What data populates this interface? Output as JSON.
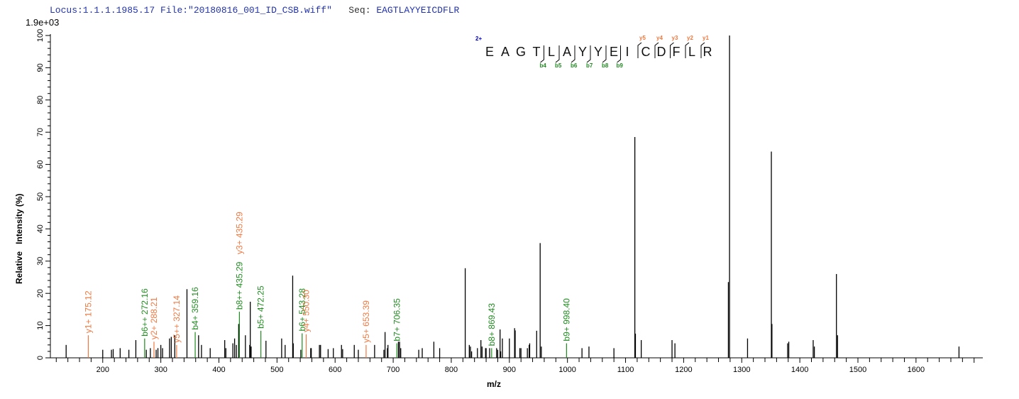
{
  "header": {
    "locus": "Locus:1.1.1.1985.17",
    "file": "File:\"20180816_001_ID_CSB.wiff\"",
    "seq_label": "Seq:",
    "seq": "EAGTLAYYEICDFLR"
  },
  "colors": {
    "b_ion": "#1e8c1e",
    "y_ion": "#f07840",
    "peak": "#000000",
    "header": "#2233aa",
    "charge": "#0000cc"
  },
  "chart_data": {
    "type": "bar",
    "title": "",
    "scale_label": "1.9e+03",
    "xlabel": "m/z",
    "ylabel": "Relative   Intensity (%)",
    "xlim": [
      105,
      1715
    ],
    "ylim": [
      0,
      100
    ],
    "x_ticks": [
      200,
      300,
      400,
      500,
      600,
      700,
      800,
      900,
      1000,
      1100,
      1200,
      1300,
      1400,
      1500,
      1600
    ],
    "y_ticks": [
      0,
      10,
      20,
      30,
      40,
      50,
      60,
      70,
      80,
      90,
      100
    ],
    "grid": false,
    "sequence_annotation": {
      "charge": "2+",
      "residues": [
        "E",
        "A",
        "G",
        "T",
        "L",
        "A",
        "Y",
        "Y",
        "E",
        "I",
        "C",
        "D",
        "F",
        "L",
        "R"
      ],
      "b_ions": [
        {
          "after": 4,
          "label": "b4"
        },
        {
          "after": 5,
          "label": "b5"
        },
        {
          "after": 6,
          "label": "b6"
        },
        {
          "after": 7,
          "label": "b7"
        },
        {
          "after": 8,
          "label": "b8"
        },
        {
          "after": 9,
          "label": "b9"
        }
      ],
      "y_ions": [
        {
          "before": 11,
          "label": "y5"
        },
        {
          "before": 12,
          "label": "y4"
        },
        {
          "before": 13,
          "label": "y3"
        },
        {
          "before": 14,
          "label": "y2"
        },
        {
          "before": 15,
          "label": "y1"
        }
      ]
    },
    "peaks": [
      {
        "mz": 137,
        "i": 4
      },
      {
        "mz": 175.12,
        "i": 7,
        "label": "y1+ 175.12",
        "ion": "y"
      },
      {
        "mz": 200,
        "i": 2.5
      },
      {
        "mz": 215,
        "i": 2.5
      },
      {
        "mz": 218,
        "i": 2.7
      },
      {
        "mz": 230,
        "i": 3
      },
      {
        "mz": 245,
        "i": 2.5
      },
      {
        "mz": 257,
        "i": 5.5
      },
      {
        "mz": 272.16,
        "i": 6,
        "label": "b6++ 272.16",
        "ion": "b"
      },
      {
        "mz": 275,
        "i": 2.5
      },
      {
        "mz": 282,
        "i": 3
      },
      {
        "mz": 288.21,
        "i": 5,
        "label": "y2+ 288.21",
        "ion": "y"
      },
      {
        "mz": 292,
        "i": 2.5
      },
      {
        "mz": 295,
        "i": 3
      },
      {
        "mz": 300,
        "i": 4
      },
      {
        "mz": 303,
        "i": 3
      },
      {
        "mz": 315,
        "i": 6
      },
      {
        "mz": 318,
        "i": 6.5
      },
      {
        "mz": 324,
        "i": 7
      },
      {
        "mz": 327.14,
        "i": 4,
        "label": "y5++ 327.14",
        "ion": "y"
      },
      {
        "mz": 345,
        "i": 21.3
      },
      {
        "mz": 359.16,
        "i": 8,
        "label": "b4+ 359.16",
        "ion": "b"
      },
      {
        "mz": 365,
        "i": 7
      },
      {
        "mz": 370,
        "i": 4
      },
      {
        "mz": 385,
        "i": 3
      },
      {
        "mz": 410,
        "i": 5.5
      },
      {
        "mz": 412,
        "i": 3
      },
      {
        "mz": 424,
        "i": 4.5
      },
      {
        "mz": 427,
        "i": 6
      },
      {
        "mz": 430,
        "i": 4
      },
      {
        "mz": 434,
        "i": 10.5
      },
      {
        "mz": 435.29,
        "i": 14.3,
        "label": "b8++ 435.29",
        "ion": "b"
      },
      {
        "mz": 435.3,
        "i": 0,
        "label": "y3+ 435.29",
        "ion": "y",
        "stack": 1
      },
      {
        "mz": 445.6,
        "i": 7
      },
      {
        "mz": 453,
        "i": 4
      },
      {
        "mz": 454,
        "i": 17.4
      },
      {
        "mz": 455.5,
        "i": 3.5
      },
      {
        "mz": 472.25,
        "i": 8.4,
        "label": "b5+ 472.25",
        "ion": "b"
      },
      {
        "mz": 481,
        "i": 5.3
      },
      {
        "mz": 508,
        "i": 6
      },
      {
        "mz": 514,
        "i": 4
      },
      {
        "mz": 527,
        "i": 25.5
      },
      {
        "mz": 528,
        "i": 4.5
      },
      {
        "mz": 541,
        "i": 2.5
      },
      {
        "mz": 543.28,
        "i": 7.6,
        "label": "b6+ 543.28",
        "ion": "b"
      },
      {
        "mz": 550.3,
        "i": 7.3,
        "label": "y4+ 550.30",
        "ion": "y"
      },
      {
        "mz": 558,
        "i": 3
      },
      {
        "mz": 559,
        "i": 3
      },
      {
        "mz": 573,
        "i": 4
      },
      {
        "mz": 575,
        "i": 4
      },
      {
        "mz": 588,
        "i": 2.7
      },
      {
        "mz": 597,
        "i": 3
      },
      {
        "mz": 611,
        "i": 4
      },
      {
        "mz": 613,
        "i": 2.7
      },
      {
        "mz": 633,
        "i": 4
      },
      {
        "mz": 640,
        "i": 2.5
      },
      {
        "mz": 653.39,
        "i": 4,
        "label": "y5+ 653.39",
        "ion": "y"
      },
      {
        "mz": 668,
        "i": 4
      },
      {
        "mz": 684,
        "i": 2.5
      },
      {
        "mz": 686,
        "i": 8
      },
      {
        "mz": 690,
        "i": 3
      },
      {
        "mz": 691,
        "i": 4
      },
      {
        "mz": 706.35,
        "i": 4.5,
        "label": "b7+ 706.35",
        "ion": "b"
      },
      {
        "mz": 709,
        "i": 5
      },
      {
        "mz": 711,
        "i": 5
      },
      {
        "mz": 713,
        "i": 3
      },
      {
        "mz": 744,
        "i": 2.5
      },
      {
        "mz": 750,
        "i": 3
      },
      {
        "mz": 770,
        "i": 5
      },
      {
        "mz": 780,
        "i": 3
      },
      {
        "mz": 824,
        "i": 27.8
      },
      {
        "mz": 831,
        "i": 4
      },
      {
        "mz": 833,
        "i": 3.5
      },
      {
        "mz": 835,
        "i": 2
      },
      {
        "mz": 845,
        "i": 3
      },
      {
        "mz": 851,
        "i": 5.5
      },
      {
        "mz": 853,
        "i": 3.5
      },
      {
        "mz": 859,
        "i": 3
      },
      {
        "mz": 860,
        "i": 3
      },
      {
        "mz": 866,
        "i": 3
      },
      {
        "mz": 869.43,
        "i": 3,
        "label": "b8+ 869.43",
        "ion": "b"
      },
      {
        "mz": 878,
        "i": 3
      },
      {
        "mz": 880,
        "i": 2.5
      },
      {
        "mz": 884,
        "i": 8.8
      },
      {
        "mz": 885,
        "i": 2
      },
      {
        "mz": 888,
        "i": 6
      },
      {
        "mz": 900,
        "i": 6
      },
      {
        "mz": 909,
        "i": 9.2
      },
      {
        "mz": 910,
        "i": 8.5
      },
      {
        "mz": 918,
        "i": 3
      },
      {
        "mz": 920,
        "i": 3
      },
      {
        "mz": 931,
        "i": 3
      },
      {
        "mz": 934,
        "i": 4
      },
      {
        "mz": 935,
        "i": 4.5
      },
      {
        "mz": 947,
        "i": 8.4
      },
      {
        "mz": 953,
        "i": 35.6
      },
      {
        "mz": 955,
        "i": 3.5
      },
      {
        "mz": 998.4,
        "i": 4.5,
        "label": "b9+ 998.40",
        "ion": "b"
      },
      {
        "mz": 1025,
        "i": 3
      },
      {
        "mz": 1037,
        "i": 3.5
      },
      {
        "mz": 1080,
        "i": 3
      },
      {
        "mz": 1116,
        "i": 68.5
      },
      {
        "mz": 1117,
        "i": 7.5
      },
      {
        "mz": 1127,
        "i": 5.5
      },
      {
        "mz": 1180,
        "i": 5.5
      },
      {
        "mz": 1185,
        "i": 4.5
      },
      {
        "mz": 1277,
        "i": 23.5
      },
      {
        "mz": 1279,
        "i": 100
      },
      {
        "mz": 1310,
        "i": 6
      },
      {
        "mz": 1351,
        "i": 64
      },
      {
        "mz": 1352,
        "i": 10.5
      },
      {
        "mz": 1379,
        "i": 4.5
      },
      {
        "mz": 1381,
        "i": 5
      },
      {
        "mz": 1423,
        "i": 5.5
      },
      {
        "mz": 1425,
        "i": 3.5
      },
      {
        "mz": 1463,
        "i": 26
      },
      {
        "mz": 1465,
        "i": 7
      },
      {
        "mz": 1674,
        "i": 3.5
      }
    ]
  }
}
